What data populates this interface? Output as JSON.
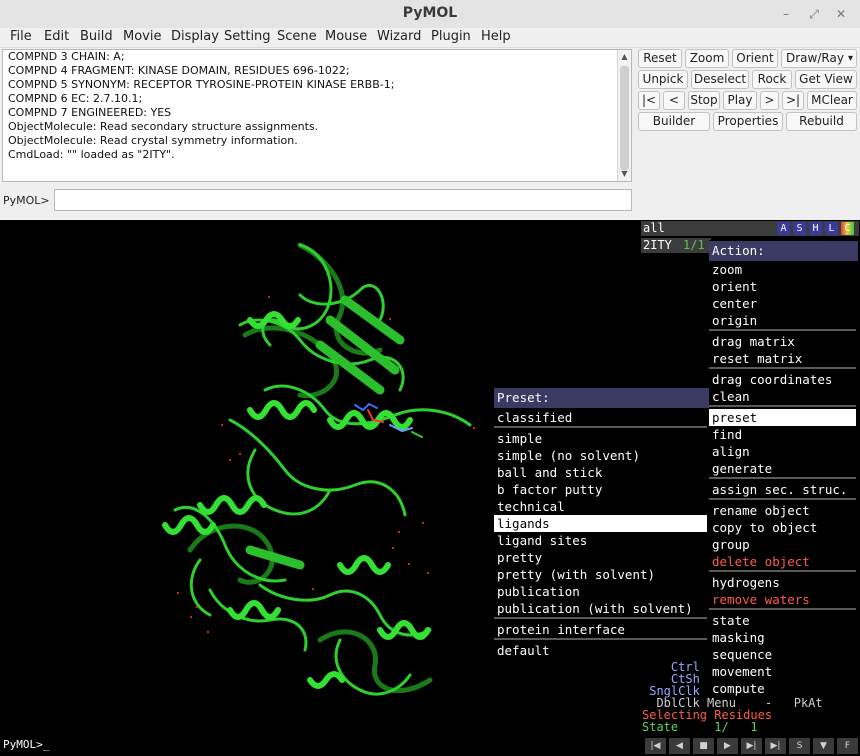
{
  "window": {
    "title": "PyMOL",
    "controls": {
      "minimize": "–",
      "restore": "⤢",
      "close": "✕"
    }
  },
  "menubar": [
    "File",
    "Edit",
    "Build",
    "Movie",
    "Display",
    "Setting",
    "Scene",
    "Mouse",
    "Wizard",
    "Plugin",
    "Help"
  ],
  "log": {
    "lines": [
      "COMPND   3 CHAIN: A;",
      "COMPND   4 FRAGMENT: KINASE DOMAIN, RESIDUES 696-1022;",
      "COMPND   5 SYNONYM: RECEPTOR TYROSINE-PROTEIN KINASE ERBB-1;",
      "COMPND   6 EC: 2.7.10.1;",
      "COMPND   7 ENGINEERED: YES",
      " ObjectMolecule: Read secondary structure assignments.",
      " ObjectMolecule: Read crystal symmetry information.",
      " CmdLoad: \"\" loaded as \"2ITY\"."
    ],
    "scroll_up": "▲",
    "scroll_down": "▼"
  },
  "command": {
    "label": "PyMOL>",
    "value": ""
  },
  "buttons": {
    "row1": [
      "Reset",
      "Zoom",
      "Orient",
      "Draw/Ray"
    ],
    "draw_ray_arrow": "▾",
    "row2": [
      "Unpick",
      "Deselect",
      "Rock",
      "Get View"
    ],
    "row3": [
      "|<",
      "<",
      "Stop",
      "Play",
      ">",
      ">|",
      "MClear"
    ],
    "row4": [
      "Builder",
      "Properties",
      "Rebuild"
    ]
  },
  "objects": {
    "all": {
      "name": "all",
      "toggles": [
        "A",
        "S",
        "H",
        "L",
        "C"
      ]
    },
    "items": [
      {
        "name": "2ITY",
        "state": "1/1"
      }
    ]
  },
  "mouse_info": [
    {
      "text": "    Ctrl  ",
      "color": "#9aa7ff"
    },
    {
      "text": "    CtSh  ",
      "color": "#9aa7ff"
    },
    {
      "text": " SnglClk  ",
      "color": "#9aa7ff"
    },
    {
      "text": "  DblClk Menu    -   PkAt",
      "color": "#cfcfcf"
    },
    {
      "text": "Selecting Residues",
      "color": "#ff5a4e"
    },
    {
      "text": "State     1/   1",
      "color": "#5fd35f"
    }
  ],
  "viewer_prompt": "PyMOL>_",
  "transport": [
    "|◀",
    "◀",
    "■",
    "▶",
    "▶|",
    "▶|",
    "S",
    "▼",
    "F"
  ],
  "action_menu": {
    "title": "Action:",
    "groups": [
      [
        "zoom",
        "orient",
        "center",
        "origin"
      ],
      [
        "drag matrix",
        "reset matrix"
      ],
      [
        "drag coordinates",
        "clean"
      ],
      [
        "preset",
        "find",
        "align",
        "generate"
      ],
      [
        "assign sec. struc."
      ],
      [
        "rename object",
        "copy to object",
        "group",
        "delete object"
      ],
      [
        "hydrogens",
        "remove waters"
      ],
      [
        "state",
        "masking",
        "sequence",
        "movement",
        "compute"
      ]
    ],
    "selected": "preset",
    "red_items": [
      "delete object",
      "remove waters"
    ]
  },
  "preset_menu": {
    "title": "Preset:",
    "groups": [
      [
        "classified"
      ],
      [
        "simple",
        "simple (no solvent)",
        "ball and stick",
        "b factor putty",
        "technical",
        "ligands",
        "ligand sites",
        "pretty",
        "pretty (with solvent)",
        "publication",
        "publication (with solvent)"
      ],
      [
        "protein interface"
      ],
      [
        "default"
      ]
    ],
    "selected": "ligands"
  },
  "colors": {
    "cartoon": "#2fcf2f",
    "cartoon_dark": "#1f8f1f",
    "menu_header": "#3a3a62",
    "warning_red": "#ff5a4e",
    "object_state": "#5fbf5f"
  }
}
